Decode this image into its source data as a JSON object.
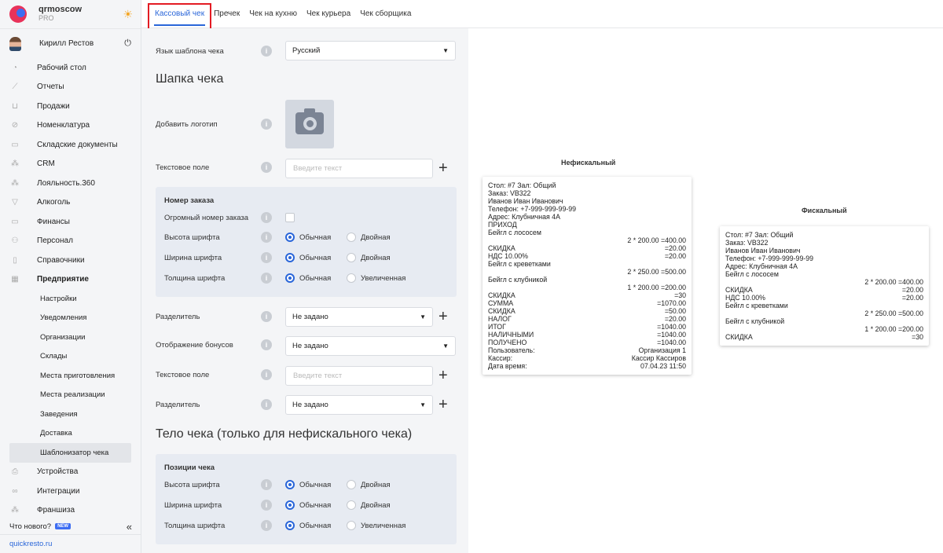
{
  "brand": {
    "name": "qrmoscow",
    "plan": "PRO"
  },
  "user": {
    "name": "Кирилл Рестов"
  },
  "nav": [
    {
      "label": "Рабочий стол"
    },
    {
      "label": "Отчеты"
    },
    {
      "label": "Продажи"
    },
    {
      "label": "Номенклатура"
    },
    {
      "label": "Складские документы"
    },
    {
      "label": "CRM"
    },
    {
      "label": "Лояльность.360"
    },
    {
      "label": "Алкоголь"
    },
    {
      "label": "Финансы"
    },
    {
      "label": "Персонал"
    },
    {
      "label": "Справочники"
    },
    {
      "label": "Предприятие"
    }
  ],
  "subnav": [
    {
      "label": "Настройки"
    },
    {
      "label": "Уведомления"
    },
    {
      "label": "Организации"
    },
    {
      "label": "Склады"
    },
    {
      "label": "Места приготовления"
    },
    {
      "label": "Места реализации"
    },
    {
      "label": "Заведения"
    },
    {
      "label": "Доставка"
    },
    {
      "label": "Шаблонизатор чека"
    }
  ],
  "nav2": [
    {
      "label": "Устройства"
    },
    {
      "label": "Интеграции"
    },
    {
      "label": "Франшиза"
    }
  ],
  "whatsnew": {
    "label": "Что нового?",
    "badge": "NEW"
  },
  "site": "quickresto.ru",
  "tabs": [
    {
      "label": "Кассовый чек"
    },
    {
      "label": "Пречек"
    },
    {
      "label": "Чек на кухню"
    },
    {
      "label": "Чек курьера"
    },
    {
      "label": "Чек сборщика"
    }
  ],
  "form": {
    "lang_label": "Язык шаблона чека",
    "lang_value": "Русский",
    "header_title": "Шапка чека",
    "logo_label": "Добавить логотип",
    "text1_label": "Текстовое поле",
    "text1_placeholder": "Введите текст",
    "order": {
      "title": "Номер заказа",
      "huge_label": "Огромный номер заказа",
      "height_label": "Высота шрифта",
      "width_label": "Ширина шрифта",
      "weight_label": "Толщина шрифта",
      "normal": "Обычная",
      "double": "Двойная",
      "bold": "Увеличенная"
    },
    "sep1_label": "Разделитель",
    "sep1_value": "Не задано",
    "bonus_label": "Отображение бонусов",
    "bonus_value": "Не задано",
    "text2_label": "Текстовое поле",
    "text2_placeholder": "Введите текст",
    "sep2_label": "Разделитель",
    "sep2_value": "Не задано",
    "body_title": "Тело чека (только для нефискального чека)",
    "positions": {
      "title": "Позиции чека",
      "height_label": "Высота шрифта",
      "width_label": "Ширина шрифта",
      "weight_label": "Толщина шрифта",
      "normal": "Обычная",
      "double": "Двойная",
      "bold": "Увеличенная"
    }
  },
  "nonfiscal": {
    "title": "Нефискальный",
    "lines": [
      {
        "t": "Стол: #7 Зал: Общий"
      },
      {
        "t": "Заказ: VB322"
      },
      {
        "t": "Иванов Иван Иванович"
      },
      {
        "t": "Телефон: +7-999-999-99-99"
      },
      {
        "t": "Адрес: Клубничная 4А"
      },
      {
        "t": "ПРИХОД"
      },
      {
        "t": "Бейгл с лососем"
      },
      {
        "r": "2 * 200.00 =400.00"
      },
      {
        "l": "СКИДКА",
        "r": "=20.00"
      },
      {
        "l": "НДС 10.00%",
        "r": "=20.00"
      },
      {
        "t": "Бейгл с креветками"
      },
      {
        "r": "2 * 250.00 =500.00"
      },
      {
        "t": "Бейгл с клубникой"
      },
      {
        "r": "1 * 200.00 =200.00"
      },
      {
        "l": "СКИДКА",
        "r": "=30"
      },
      {
        "l": "СУММА",
        "r": "=1070.00"
      },
      {
        "l": "СКИДКА",
        "r": "=50.00"
      },
      {
        "l": "НАЛОГ",
        "r": "=20.00"
      },
      {
        "l": "ИТОГ",
        "r": "=1040.00"
      },
      {
        "l": "НАЛИЧНЫМИ",
        "r": "=1040.00"
      },
      {
        "l": "ПОЛУЧЕНО",
        "r": "=1040.00"
      },
      {
        "l": "Пользователь:",
        "r": "Организация 1"
      },
      {
        "l": "Кассир:",
        "r": "Кассир Кассиров"
      },
      {
        "l": "Дата время:",
        "r": "07.04.23 11:50"
      }
    ]
  },
  "fiscal": {
    "title": "Фискальный",
    "lines": [
      {
        "t": "Стол: #7 Зал: Общий"
      },
      {
        "t": "Заказ: VB322"
      },
      {
        "t": "Иванов Иван Иванович"
      },
      {
        "t": "Телефон: +7-999-999-99-99"
      },
      {
        "t": "Адрес: Клубничная 4А"
      },
      {
        "t": "Бейгл с лососем"
      },
      {
        "r": "2 * 200.00 =400.00"
      },
      {
        "l": "СКИДКА",
        "r": "=20.00"
      },
      {
        "l": "НДС 10.00%",
        "r": "=20.00"
      },
      {
        "t": "Бейгл с креветками"
      },
      {
        "r": "2 * 250.00 =500.00"
      },
      {
        "t": "Бейгл с клубникой"
      },
      {
        "r": "1 * 200.00 =200.00"
      },
      {
        "l": "СКИДКА",
        "r": "=30"
      }
    ]
  }
}
